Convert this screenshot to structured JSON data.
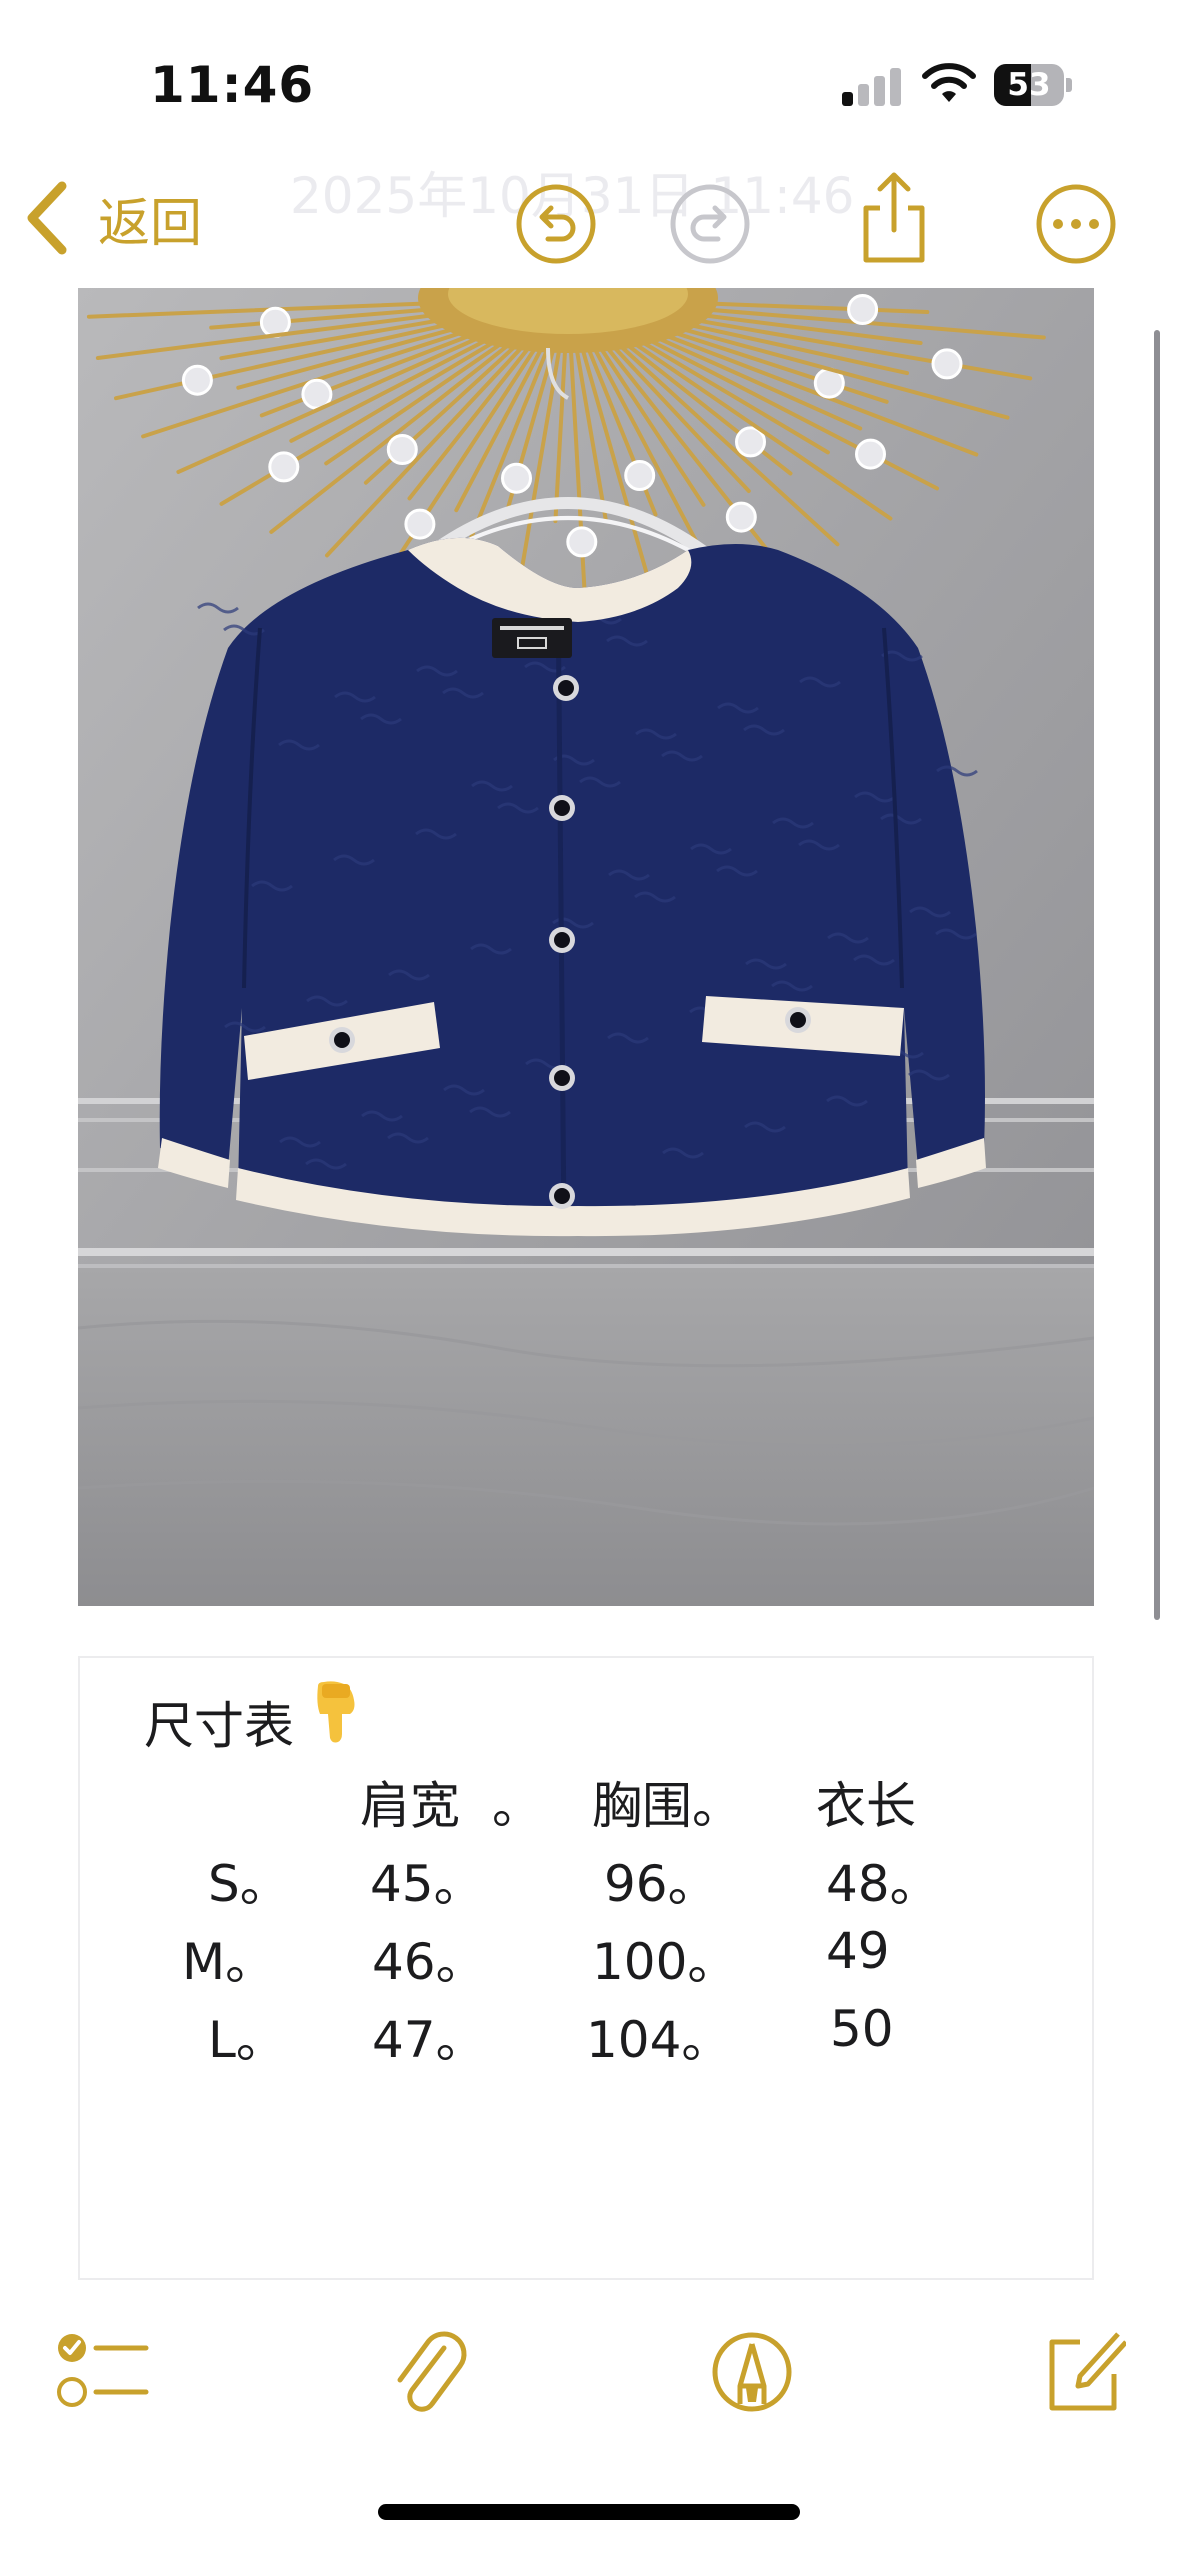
{
  "status_bar": {
    "time": "11:46",
    "battery_level": "53",
    "battery_fraction": 0.53,
    "icons": [
      "cellular-signal-icon",
      "wifi-icon",
      "battery-icon"
    ]
  },
  "nav": {
    "back_label": "返回",
    "faded_date": "2025年10月31日 11:46",
    "icons": [
      "chevron-left-icon",
      "undo-icon",
      "redo-icon",
      "share-icon",
      "more-icon"
    ]
  },
  "note": {
    "photo_subject": "navy-cardigan-photo",
    "heading": "尺寸表",
    "heading_emoji": "👇",
    "headers": [
      "肩宽",
      "。",
      "胸围。",
      "衣长"
    ],
    "rows": [
      {
        "size": "S。",
        "shoulder": "45。",
        "chest": "96。",
        "length": "48。"
      },
      {
        "size": "M。",
        "shoulder": "46。",
        "chest": "100。",
        "length": "49"
      },
      {
        "size": "L。",
        "shoulder": "47。",
        "chest": "104。",
        "length": "50"
      }
    ]
  },
  "toolbar": {
    "icons": [
      "checklist-icon",
      "paperclip-icon",
      "markup-pen-icon",
      "compose-icon"
    ]
  },
  "colors": {
    "accent": "#c8a12c",
    "text": "#1c1c1e",
    "card_border": "#ececee",
    "cardigan_navy": "#1d2a66",
    "cardigan_trim": "#f2ebe0"
  }
}
